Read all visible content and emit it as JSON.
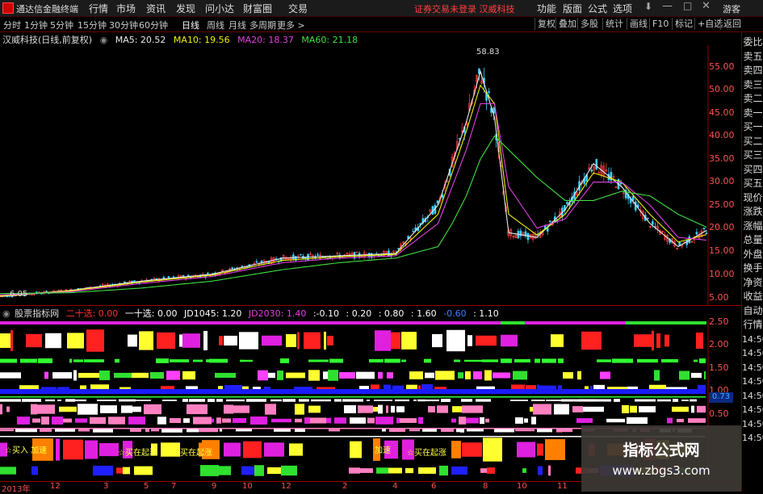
{
  "app": {
    "title": "通达信金融终端",
    "menus": [
      "行情",
      "市场",
      "资讯",
      "发现",
      "问小达",
      "财富圈",
      "交易"
    ],
    "notice": "证券交易未登录  汉威科技",
    "right_menus": [
      "功能",
      "版面",
      "公式",
      "选项"
    ],
    "guest": "游客"
  },
  "toolbar": {
    "periods": [
      "分时",
      "1分钟",
      "5分钟",
      "15分钟",
      "30分钟",
      "60分钟",
      "日线",
      "周线",
      "月线",
      "多周期",
      "更多 >"
    ],
    "active_period": "日线",
    "buttons": [
      "复权",
      "叠加",
      "多股",
      "统计",
      "画线",
      "F10",
      "标记",
      "+自选",
      "返回"
    ]
  },
  "chart": {
    "stock_label": "汉威科技(日线,前复权)",
    "ma": [
      {
        "label": "MA5: 20.52",
        "color": "#e8e8e8"
      },
      {
        "label": "MA10: 19.56",
        "color": "#f0f000"
      },
      {
        "label": "MA20: 18.37",
        "color": "#e040e0"
      },
      {
        "label": "MA60: 21.18",
        "color": "#40e040"
      }
    ],
    "price_ticks": [
      "55.00",
      "50.00",
      "45.00",
      "40.00",
      "35.00",
      "30.00",
      "25.00",
      "20.00",
      "15.00",
      "10.00",
      "5.00"
    ],
    "high_label": "58.83",
    "low_label": "6.05",
    "sidebar": [
      "委比",
      "卖五",
      "卖四",
      "卖三",
      "卖二",
      "卖一",
      "买一",
      "买二",
      "买三",
      "买四",
      "买五",
      "现价",
      "涨跌",
      "涨幅",
      "总量",
      "外盘",
      "换手",
      "净资",
      "收益",
      "自动",
      "行情"
    ]
  },
  "chart_data": {
    "type": "line",
    "title": "汉威科技(日线,前复权)",
    "ylim": [
      5,
      60
    ],
    "x": [
      0,
      10,
      20,
      30,
      40,
      48,
      56,
      62,
      64,
      66,
      68,
      70,
      72,
      76,
      80,
      84,
      88,
      92,
      96,
      100
    ],
    "series": [
      {
        "name": "MA5",
        "values": [
          6.2,
          7.5,
          9.5,
          11.0,
          14.5,
          15.0,
          15.5,
          26.0,
          35.0,
          44.0,
          55.0,
          45.0,
          20.0,
          19.0,
          25.0,
          35.0,
          30.0,
          22.0,
          17.0,
          20.5
        ]
      },
      {
        "name": "MA10",
        "values": [
          6.3,
          7.4,
          9.3,
          10.8,
          14.0,
          14.8,
          15.3,
          24.0,
          33.0,
          42.0,
          52.0,
          48.0,
          24.0,
          19.5,
          24.0,
          33.0,
          31.0,
          24.0,
          18.0,
          19.6
        ]
      },
      {
        "name": "MA20",
        "values": [
          6.5,
          7.2,
          9.0,
          10.5,
          13.5,
          14.5,
          15.0,
          22.0,
          30.0,
          38.0,
          48.0,
          48.0,
          30.0,
          21.0,
          23.0,
          31.0,
          31.0,
          26.0,
          19.0,
          18.4
        ]
      },
      {
        "name": "MA60",
        "values": [
          6.8,
          7.0,
          8.0,
          9.5,
          12.0,
          13.5,
          14.5,
          17.0,
          22.0,
          28.0,
          36.0,
          41.0,
          38.0,
          32.0,
          27.0,
          27.0,
          29.0,
          28.0,
          24.0,
          21.2
        ]
      }
    ]
  },
  "indicator": {
    "name": "股票指标网",
    "params": [
      {
        "label": "二十选: 0.00",
        "color": "#ff3030"
      },
      {
        "label": "一十选: 0.00",
        "color": "#ffffff"
      },
      {
        "label": "JD1045: 1.20",
        "color": "#ffffff"
      },
      {
        "label": "JD2030: 1.40",
        "color": "#e040e0"
      },
      {
        "label": ":-0.10",
        "color": "#ffffff"
      },
      {
        "label": ": 0.20",
        "color": "#ffffff"
      },
      {
        "label": ": 0.80",
        "color": "#ffffff"
      },
      {
        "label": ": 1.60",
        "color": "#ffffff"
      },
      {
        "label": "-0.60",
        "color": "#4080ff"
      },
      {
        "label": ": 1.10",
        "color": "#ffffff"
      }
    ],
    "ticks": [
      "2.50",
      "2.00",
      "1.50",
      "1.00",
      "0.50"
    ],
    "current": "0.73",
    "annotations": [
      "☆买入 加速",
      "☆买在起涨",
      "☆买在起涨",
      "加速",
      "☆买在起涨"
    ]
  },
  "xaxis": [
    "2013年",
    "12",
    "3",
    "5",
    "7",
    "9",
    "10",
    "12",
    "2",
    "4",
    "6",
    "8",
    "10",
    "11"
  ],
  "watermark": {
    "line1": "指标公式网",
    "line2": "www.zbgs3.com"
  }
}
